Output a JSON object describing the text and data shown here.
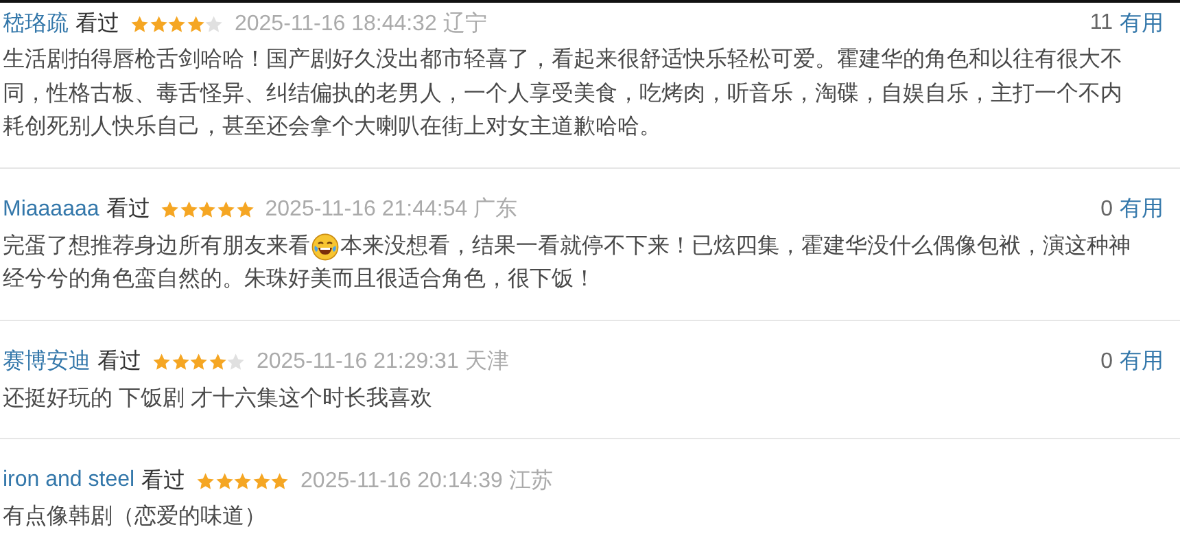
{
  "comments": [
    {
      "user": "嵇珞疏",
      "status": "看过",
      "stars": 4,
      "time": "2025-11-16 18:44:32",
      "region": "辽宁",
      "votes": "11",
      "vote_label": "有用",
      "content": [
        [
          "生活剧拍得唇枪舌剑哈哈！国产剧好久没出都市轻喜了，看起来很舒适快乐轻松可爱。霍建华的角色和以往有很大不"
        ],
        [
          "同，性格古板、毒舌怪异、纠结偏执的老男人，一个人享受美食，吃烤肉，听音乐，淘碟，自娱自乐，主打一个不内"
        ],
        [
          "耗创死别人快乐自己，甚至还会拿个大喇叭在街上对女主道歉哈哈。"
        ]
      ]
    },
    {
      "user": "Miaaaaaa",
      "status": "看过",
      "stars": 5,
      "time": "2025-11-16 21:44:54",
      "region": "广东",
      "votes": "0",
      "vote_label": "有用",
      "content": [
        [
          "完蛋了想推荐身边所有朋友来看",
          "本来没想看，结果一看就停不下来！已炫四集，霍建华没什么偶像包袱，演这种神"
        ],
        [
          "经兮兮的角色蛮自然的。朱珠好美而且很适合角色，很下饭！"
        ]
      ]
    },
    {
      "user": "赛博安迪",
      "status": "看过",
      "stars": 4,
      "time": "2025-11-16 21:29:31",
      "region": "天津",
      "votes": "0",
      "vote_label": "有用",
      "content": [
        [
          "还挺好玩的 下饭剧 才十六集这个时长我喜欢"
        ]
      ]
    },
    {
      "user": "iron and steel",
      "status": "看过",
      "stars": 5,
      "time": "2025-11-16 20:14:39",
      "region": "江苏",
      "content": [
        [
          "有点像韩剧（恋爱的味道）"
        ]
      ]
    }
  ]
}
